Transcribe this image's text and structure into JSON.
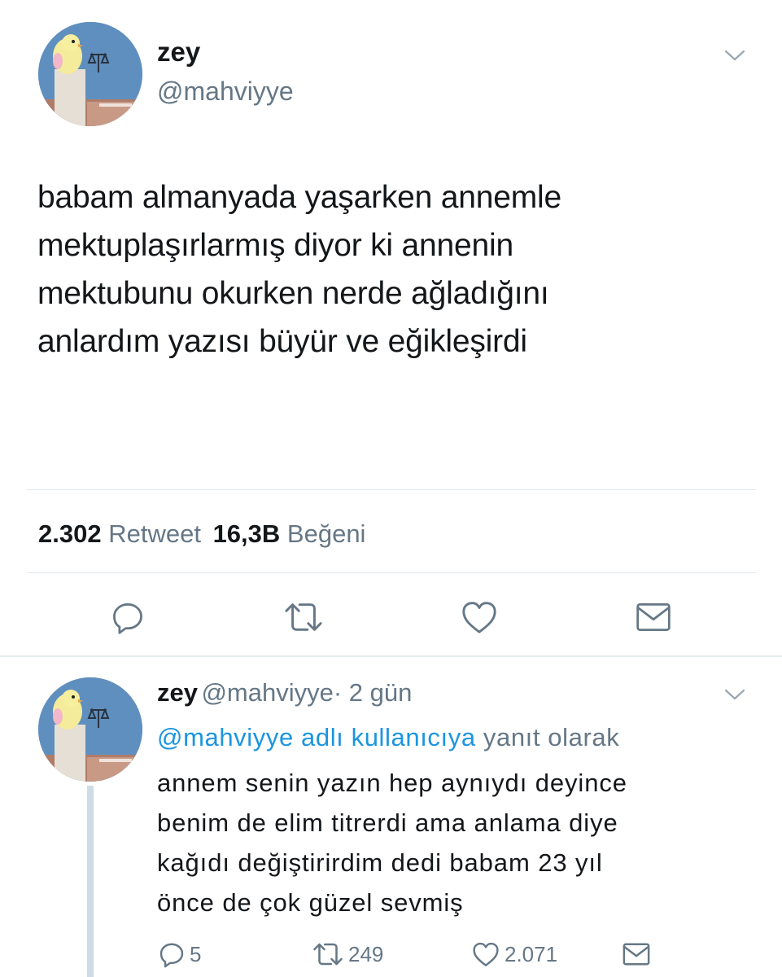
{
  "main_tweet": {
    "author_name": "zey",
    "author_handle": "@mahviyye",
    "text": "babam almanyada yaşarken annemle\nmektuplaşırlarmış diyor ki annenin\nmektubunu okurken nerde ağladığını\nanlardım yazısı büyür ve eğikleşirdi",
    "stats": {
      "retweets": "2.302",
      "retweets_label": "Retweet",
      "likes": "16,3B",
      "likes_label": "Beğeni"
    }
  },
  "reply": {
    "author_name": "zey",
    "author_handle": "@mahviyye",
    "time": "· 2 gün",
    "context_link": "@mahviyye adlı kullanıcıya",
    "context_suffix": "yanıt olarak",
    "text": "annem senin yazın hep aynıydı deyince\nbenim de elim titrerdi ama anlama diye\nkağıdı değiştirirdim dedi babam 23 yıl\nönce de çok güzel sevmiş",
    "replies": "5",
    "retweets": "249",
    "likes": "2.071"
  },
  "icons": [
    "chevron-down-icon",
    "reply-icon",
    "retweet-icon",
    "heart-icon",
    "direct-message-icon"
  ],
  "colors": {
    "text": "#14171a",
    "secondary": "#657786",
    "link": "#1b95e0",
    "divider": "#e1e8ed"
  }
}
